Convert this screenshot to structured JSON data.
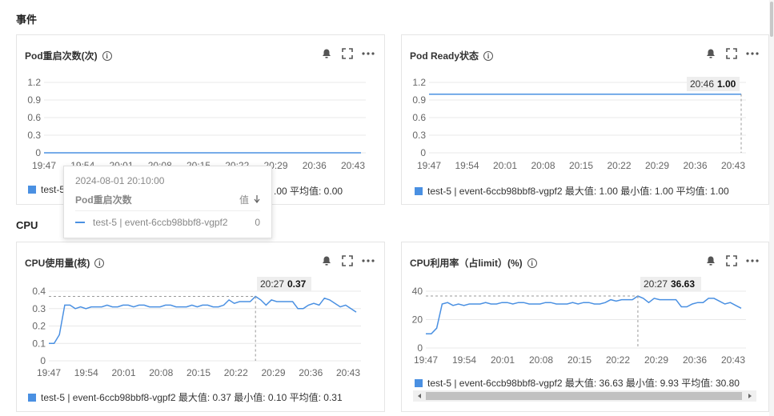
{
  "sections": {
    "events": "事件",
    "cpu": "CPU"
  },
  "colors": {
    "series": "#4a90e2",
    "grid": "#e8e8e8",
    "axis": "#666666"
  },
  "icons": [
    "info-icon",
    "bell-icon",
    "fullscreen-icon",
    "more-icon"
  ],
  "panels": {
    "pod_restart": {
      "title": "Pod重启次数(次)",
      "legend_prefix": "test-5",
      "legend_tail": ".00 平均值: 0.00"
    },
    "pod_ready": {
      "title": "Pod Ready状态",
      "legend": "test-5 | event-6ccb98bbf8-vgpf2  最大值: 1.00  最小值: 1.00  平均值: 1.00",
      "hover": {
        "time": "20:46",
        "value": "1.00"
      }
    },
    "cpu_usage": {
      "title": "CPU使用量(核)",
      "legend": "test-5 | event-6ccb98bbf8-vgpf2  最大值: 0.37  最小值: 0.10  平均值: 0.31",
      "hover": {
        "time": "20:27",
        "value": "0.37"
      }
    },
    "cpu_util": {
      "title": "CPU利用率（占limit）(%)",
      "legend": "test-5 | event-6ccb98bbf8-vgpf2  最大值: 36.63  最小值: 9.93  平均值: 30.80",
      "hover": {
        "time": "20:27",
        "value": "36.63"
      }
    }
  },
  "tooltip": {
    "time": "2024-08-01 20:10:00",
    "metric": "Pod重启次数",
    "col_value": "值",
    "series": "test-5 | event-6ccb98bbf8-vgpf2",
    "value": "0"
  },
  "chart_data": [
    {
      "type": "line",
      "title": "Pod重启次数(次)",
      "x": [
        "19:47",
        "19:54",
        "20:01",
        "20:08",
        "20:15",
        "20:22",
        "20:29",
        "20:36",
        "20:43"
      ],
      "yticks": [
        "1.2",
        "0.9",
        "0.6",
        "0.3",
        "0"
      ],
      "ylim": [
        0,
        1.2
      ],
      "series": [
        {
          "name": "test-5 | event-6ccb98bbf8-vgpf2",
          "values": [
            0,
            0,
            0,
            0,
            0,
            0,
            0,
            0,
            0
          ]
        }
      ]
    },
    {
      "type": "line",
      "title": "Pod Ready状态",
      "x": [
        "19:47",
        "19:54",
        "20:01",
        "20:08",
        "20:15",
        "20:22",
        "20:29",
        "20:36",
        "20:43"
      ],
      "yticks": [
        "1.2",
        "0.9",
        "0.6",
        "0.3",
        "0"
      ],
      "ylim": [
        0,
        1.2
      ],
      "series": [
        {
          "name": "test-5 | event-6ccb98bbf8-vgpf2",
          "values": [
            1,
            1,
            1,
            1,
            1,
            1,
            1,
            1,
            1
          ]
        }
      ]
    },
    {
      "type": "line",
      "title": "CPU使用量(核)",
      "x": [
        "19:47",
        "19:54",
        "20:01",
        "20:08",
        "20:15",
        "20:22",
        "20:29",
        "20:36",
        "20:43"
      ],
      "yticks": [
        "0.4",
        "0.3",
        "0.2",
        "0.1",
        "0"
      ],
      "ylim": [
        0,
        0.4
      ],
      "series": [
        {
          "name": "test-5 | event-6ccb98bbf8-vgpf2",
          "values": [
            0.1,
            0.1,
            0.15,
            0.32,
            0.32,
            0.3,
            0.31,
            0.3,
            0.31,
            0.31,
            0.31,
            0.32,
            0.31,
            0.31,
            0.32,
            0.32,
            0.31,
            0.32,
            0.32,
            0.31,
            0.31,
            0.31,
            0.32,
            0.32,
            0.31,
            0.31,
            0.31,
            0.32,
            0.31,
            0.32,
            0.32,
            0.31,
            0.31,
            0.32,
            0.35,
            0.33,
            0.34,
            0.34,
            0.34,
            0.37,
            0.35,
            0.32,
            0.35,
            0.34,
            0.34,
            0.34,
            0.34,
            0.3,
            0.3,
            0.32,
            0.33,
            0.32,
            0.36,
            0.35,
            0.33,
            0.31,
            0.32,
            0.3,
            0.28
          ]
        }
      ]
    },
    {
      "type": "line",
      "title": "CPU利用率（占limit）(%)",
      "x": [
        "19:47",
        "19:54",
        "20:01",
        "20:08",
        "20:15",
        "20:22",
        "20:29",
        "20:36",
        "20:43"
      ],
      "yticks": [
        "40",
        "20",
        "0"
      ],
      "ylim": [
        0,
        40
      ],
      "series": [
        {
          "name": "test-5 | event-6ccb98bbf8-vgpf2",
          "values": [
            10,
            10,
            14,
            31,
            32,
            30,
            31,
            30,
            31,
            31,
            31,
            32,
            31,
            31,
            32,
            32,
            31,
            32,
            32,
            31,
            31,
            31,
            32,
            32,
            31,
            31,
            31,
            32,
            31,
            32,
            32,
            31,
            31,
            32,
            34,
            33,
            34,
            34,
            34,
            36.6,
            35,
            32,
            35,
            34,
            34,
            34,
            34,
            29,
            29,
            31,
            32,
            32,
            35,
            35,
            33,
            31,
            32,
            30,
            28
          ]
        }
      ]
    }
  ]
}
